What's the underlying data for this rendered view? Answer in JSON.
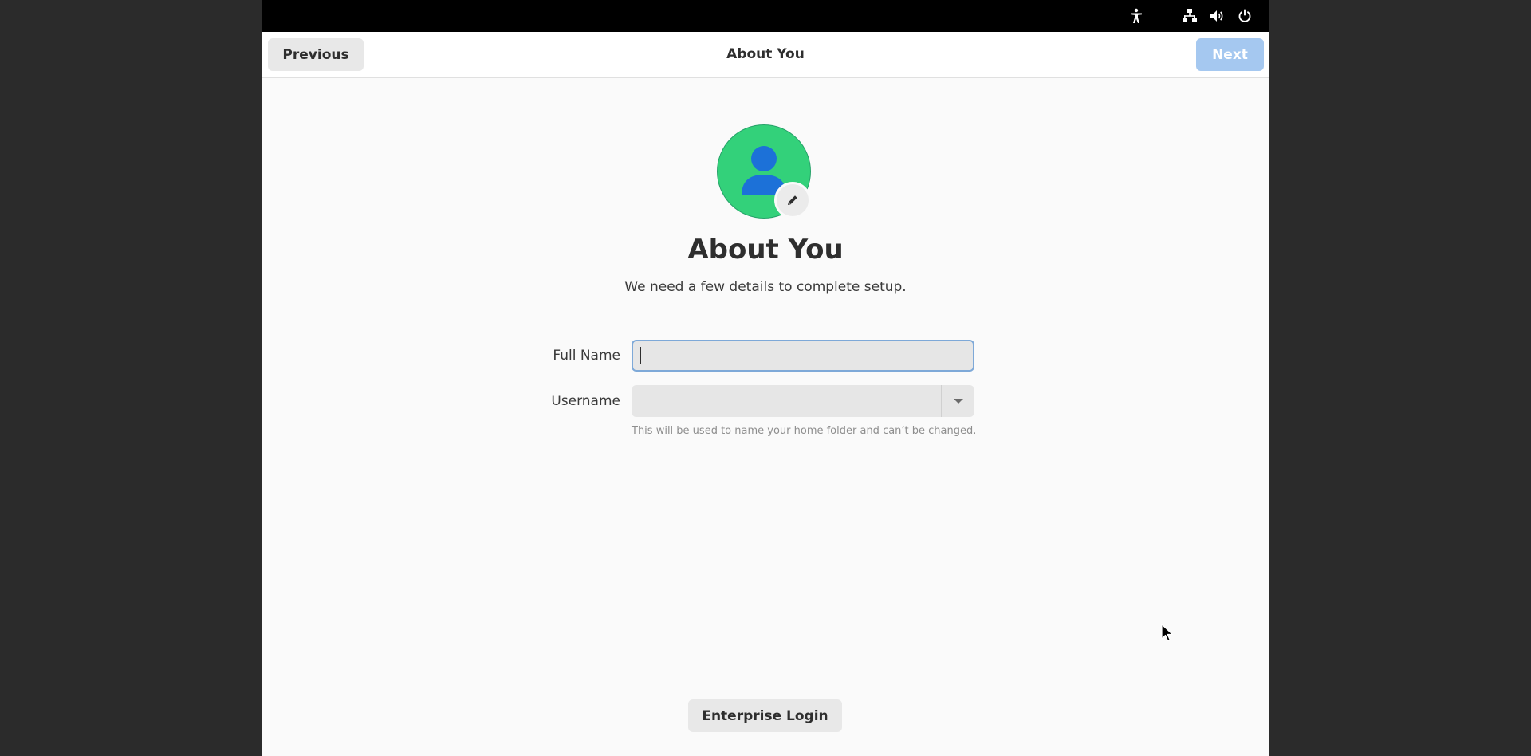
{
  "system_bar": {
    "indicators": [
      {
        "name": "accessibility-icon"
      },
      {
        "name": "network-icon"
      },
      {
        "name": "volume-icon"
      },
      {
        "name": "power-icon"
      }
    ]
  },
  "header": {
    "previous_label": "Previous",
    "title": "About You",
    "next_label": "Next",
    "next_enabled": false
  },
  "main": {
    "avatar_icon": "user-avatar-icon",
    "avatar_edit_icon": "pencil-icon",
    "title": "About You",
    "subtitle": "We need a few details to complete setup.",
    "full_name": {
      "label": "Full Name",
      "value": ""
    },
    "username": {
      "label": "Username",
      "value": "",
      "hint": "This will be used to name your home folder and can’t be changed."
    }
  },
  "footer": {
    "enterprise_login_label": "Enterprise Login"
  },
  "colors": {
    "avatar_bg": "#33d17a",
    "avatar_figure": "#1c71d8",
    "next_disabled": "#a5c8f0",
    "focus_border": "#7ea9d8"
  }
}
